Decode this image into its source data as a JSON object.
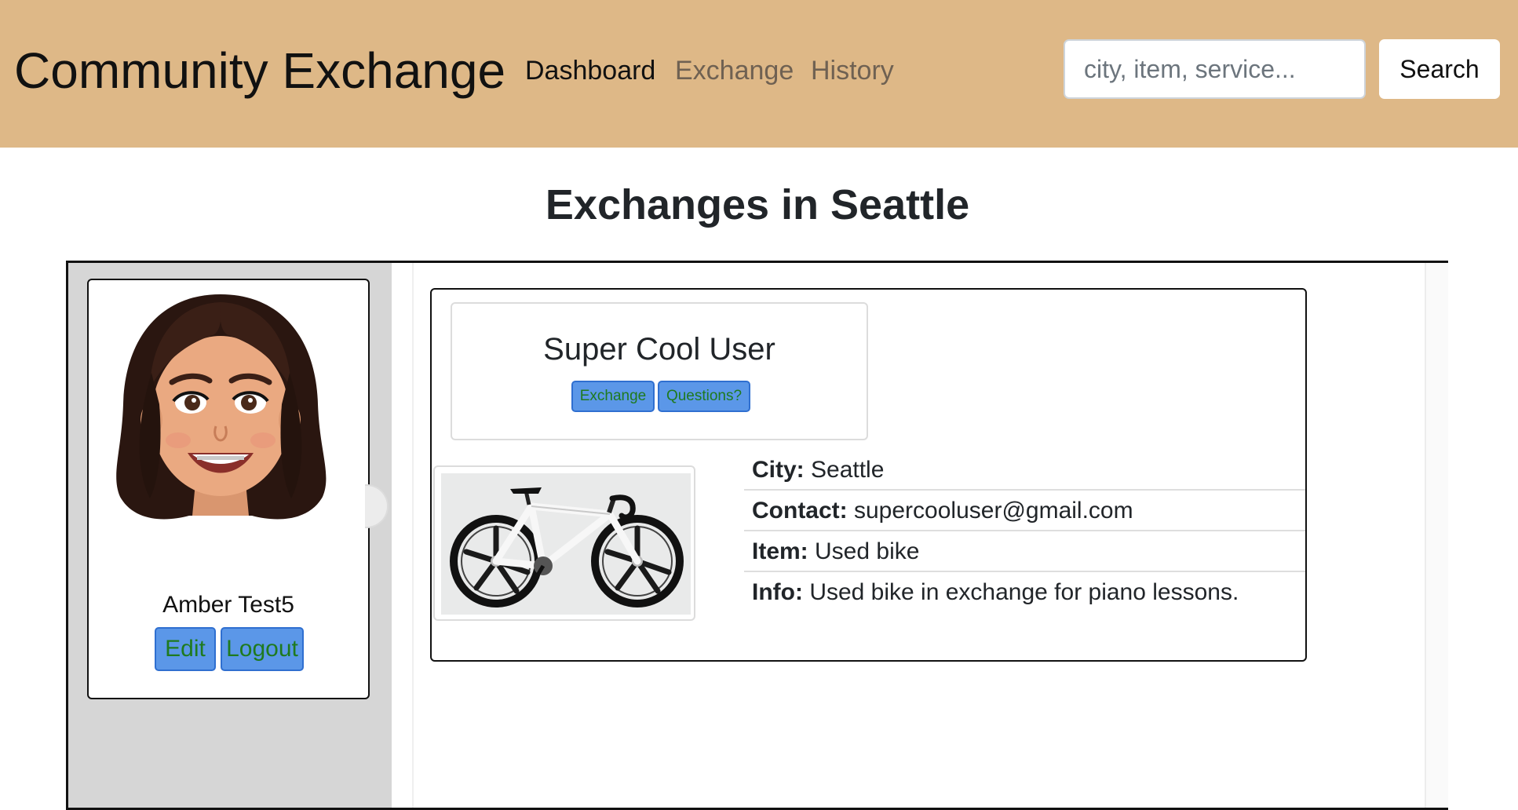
{
  "navbar": {
    "brand": "Community Exchange",
    "links": [
      {
        "label": "Dashboard",
        "active": true
      },
      {
        "label": "Exchange",
        "active": false
      },
      {
        "label": "History",
        "active": false
      }
    ],
    "search": {
      "placeholder": "city, item, service...",
      "value": "",
      "button_label": "Search"
    },
    "background_color": "#deb887"
  },
  "page": {
    "title": "Exchanges in Seattle"
  },
  "profile": {
    "name": "Amber Test5",
    "avatar_icon": "memoji-avatar-icon",
    "edit_label": "Edit",
    "logout_label": "Logout"
  },
  "listing": {
    "user_name": "Super Cool User",
    "exchange_label": "Exchange",
    "questions_label": "Questions?",
    "item_image_icon": "bicycle-photo",
    "details": [
      {
        "label": "City:",
        "value": "Seattle"
      },
      {
        "label": "Contact:",
        "value": "supercooluser@gmail.com"
      },
      {
        "label": "Item:",
        "value": "Used bike"
      },
      {
        "label": "Info:",
        "value": "Used bike in exchange for piano lessons."
      }
    ]
  },
  "colors": {
    "accent_button": "#5b97e8",
    "button_text": "#1f7a1f",
    "sidebar": "#d6d6d6"
  }
}
